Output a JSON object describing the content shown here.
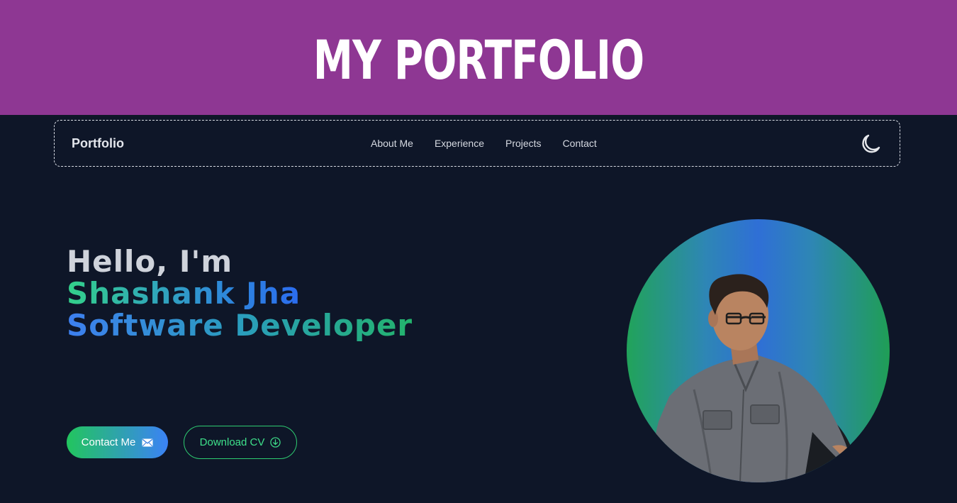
{
  "banner": {
    "title": "MY PORTFOLIO"
  },
  "navbar": {
    "brand": "Portfolio",
    "links": [
      "About Me",
      "Experience",
      "Projects",
      "Contact"
    ],
    "theme_icon": "moon-icon"
  },
  "hero": {
    "greeting": "Hello, I'm",
    "name": "Shashank Jha",
    "role": "Software Developer",
    "contact_button": "Contact Me",
    "contact_icon": "mail-icon",
    "cv_button": "Download CV",
    "cv_icon": "download-circle-icon"
  },
  "colors": {
    "banner_bg": "#8e3793",
    "page_bg": "#0e1628",
    "accent_green": "#22c55e",
    "accent_blue": "#3b82f6"
  }
}
